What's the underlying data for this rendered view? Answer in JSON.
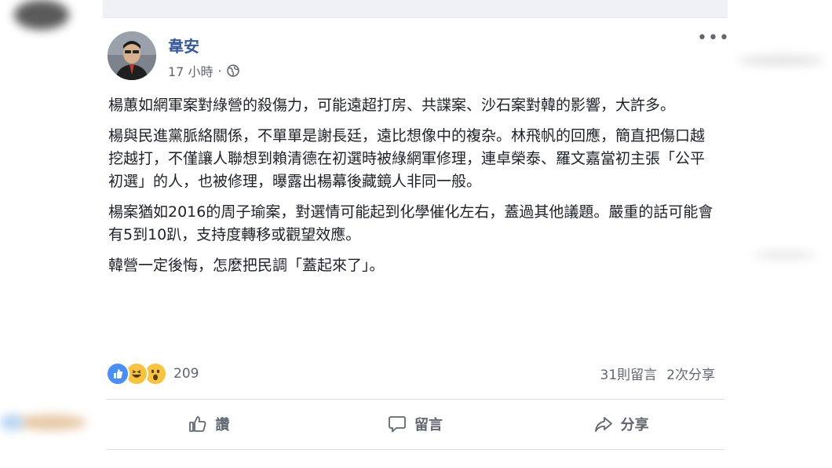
{
  "post": {
    "author": "韋安",
    "time": "17 小時",
    "separator": "·",
    "paragraphs": [
      "楊蕙如網軍案對綠營的殺傷力，可能遠超打房、共諜案、沙石案對韓的影響，大許多。",
      "楊與民進黨脈絡關係，不單單是謝長廷，遠比想像中的複杂。林飛帆的回應，簡直把傷口越挖越打，不僅讓人聯想到賴清德在初選時被綠網軍修理，連卓榮泰、羅文嘉當初主張「公平初選」的人，也被修理，曝露出楊幕後藏鏡人非同一般。",
      "楊案猶如2016的周子瑜案，對選情可能起到化學催化左右，蓋過其他議題。嚴重的話可能會有5到10趴，支持度轉移或觀望效應。",
      "韓營一定後悔，怎麼把民調「蓋起來了」。"
    ],
    "reaction_count": "209",
    "comments": "31則留言",
    "shares": "2次分享"
  },
  "actions": {
    "like": "讚",
    "comment": "留言",
    "share": "分享"
  },
  "icons": [
    "globe-icon",
    "more-icon",
    "like-reaction-icon",
    "haha-reaction-icon",
    "wow-reaction-icon",
    "thumbs-up-icon",
    "comment-icon",
    "share-icon"
  ],
  "colors": {
    "author": "#365899",
    "text": "#1d2129",
    "secondary": "#606770",
    "like": "#4c8ff2",
    "emoji": "#f6c343"
  }
}
